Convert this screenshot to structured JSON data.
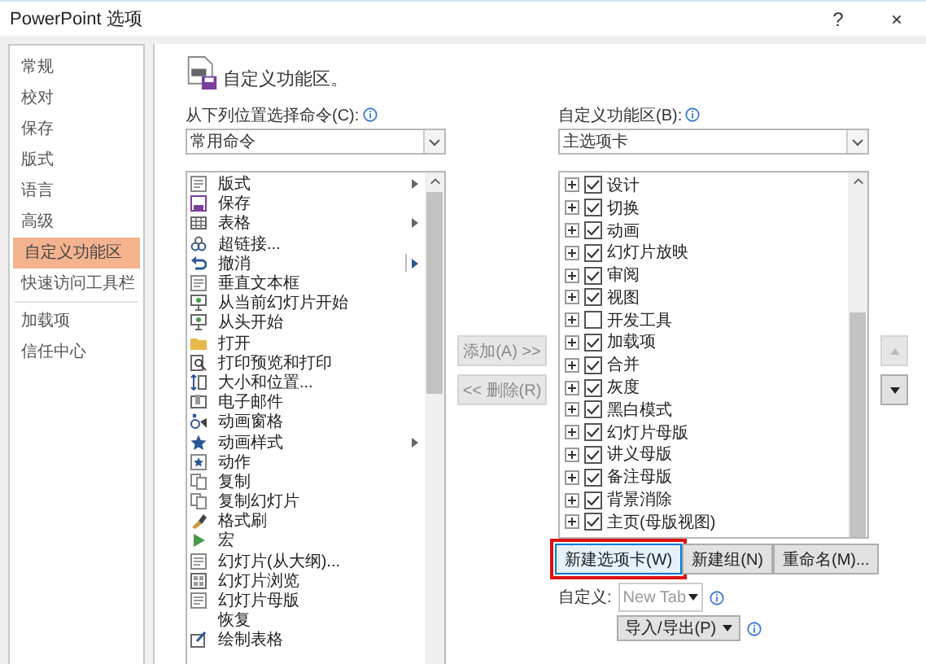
{
  "window": {
    "title": "PowerPoint 选项",
    "help": "?",
    "close": "×"
  },
  "sidebar": {
    "items": [
      {
        "label": "常规",
        "selected": false,
        "divider_after": false
      },
      {
        "label": "校对",
        "selected": false,
        "divider_after": false
      },
      {
        "label": "保存",
        "selected": false,
        "divider_after": false
      },
      {
        "label": "版式",
        "selected": false,
        "divider_after": false
      },
      {
        "label": "语言",
        "selected": false,
        "divider_after": false
      },
      {
        "label": "高级",
        "selected": false,
        "divider_after": false
      },
      {
        "label": "自定义功能区",
        "selected": true,
        "divider_after": false
      },
      {
        "label": "快速访问工具栏",
        "selected": false,
        "divider_after": true
      },
      {
        "label": "加载项",
        "selected": false,
        "divider_after": false
      },
      {
        "label": "信任中心",
        "selected": false,
        "divider_after": false
      }
    ]
  },
  "heading": "自定义功能区。",
  "commands": {
    "label": "从下列位置选择命令(C):",
    "dropdown": "常用命令",
    "items": [
      {
        "label": "版式",
        "submenu": true,
        "split": false
      },
      {
        "label": "保存",
        "submenu": false,
        "split": false
      },
      {
        "label": "表格",
        "submenu": true,
        "split": false
      },
      {
        "label": "超链接...",
        "submenu": false,
        "split": false
      },
      {
        "label": "撤消",
        "submenu": true,
        "split": true
      },
      {
        "label": "垂直文本框",
        "submenu": false,
        "split": false
      },
      {
        "label": "从当前幻灯片开始",
        "submenu": false,
        "split": false
      },
      {
        "label": "从头开始",
        "submenu": false,
        "split": false
      },
      {
        "label": "打开",
        "submenu": false,
        "split": false
      },
      {
        "label": "打印预览和打印",
        "submenu": false,
        "split": false
      },
      {
        "label": "大小和位置...",
        "submenu": false,
        "split": false
      },
      {
        "label": "电子邮件",
        "submenu": false,
        "split": false
      },
      {
        "label": "动画窗格",
        "submenu": false,
        "split": false
      },
      {
        "label": "动画样式",
        "submenu": true,
        "split": false
      },
      {
        "label": "动作",
        "submenu": false,
        "split": false
      },
      {
        "label": "复制",
        "submenu": false,
        "split": false
      },
      {
        "label": "复制幻灯片",
        "submenu": false,
        "split": false
      },
      {
        "label": "格式刷",
        "submenu": false,
        "split": false
      },
      {
        "label": "宏",
        "submenu": false,
        "split": false
      },
      {
        "label": "幻灯片(从大纲)...",
        "submenu": false,
        "split": false
      },
      {
        "label": "幻灯片浏览",
        "submenu": false,
        "split": false
      },
      {
        "label": "幻灯片母版",
        "submenu": false,
        "split": false
      },
      {
        "label": "恢复",
        "submenu": false,
        "split": false
      },
      {
        "label": "绘制表格",
        "submenu": false,
        "split": false
      }
    ]
  },
  "middle_buttons": [
    {
      "label": "添加(A) >>",
      "disabled": true
    },
    {
      "label": "<< 删除(R)",
      "disabled": true
    }
  ],
  "ribbon": {
    "label": "自定义功能区(B):",
    "dropdown": "主选项卡",
    "tabs": [
      {
        "label": "设计",
        "checked": true
      },
      {
        "label": "切换",
        "checked": true
      },
      {
        "label": "动画",
        "checked": true
      },
      {
        "label": "幻灯片放映",
        "checked": true
      },
      {
        "label": "审阅",
        "checked": true
      },
      {
        "label": "视图",
        "checked": true
      },
      {
        "label": "开发工具",
        "checked": false
      },
      {
        "label": "加载项",
        "checked": true
      },
      {
        "label": "合并",
        "checked": true
      },
      {
        "label": "灰度",
        "checked": true
      },
      {
        "label": "黑白模式",
        "checked": true
      },
      {
        "label": "幻灯片母版",
        "checked": true
      },
      {
        "label": "讲义母版",
        "checked": true
      },
      {
        "label": "备注母版",
        "checked": true
      },
      {
        "label": "背景消除",
        "checked": true
      },
      {
        "label": "主页(母版视图)",
        "checked": true
      }
    ]
  },
  "move_buttons": [
    {
      "kind": "up",
      "disabled": true
    },
    {
      "kind": "down",
      "disabled": false
    }
  ],
  "action_buttons": [
    {
      "label": "新建选项卡(W)",
      "highlighted": true
    },
    {
      "label": "新建组(N)",
      "highlighted": false
    },
    {
      "label": "重命名(M)...",
      "highlighted": false
    }
  ],
  "customize": {
    "label": "自定义:",
    "dropdown": "New Tab",
    "import_export": "导入/导出(P)"
  }
}
